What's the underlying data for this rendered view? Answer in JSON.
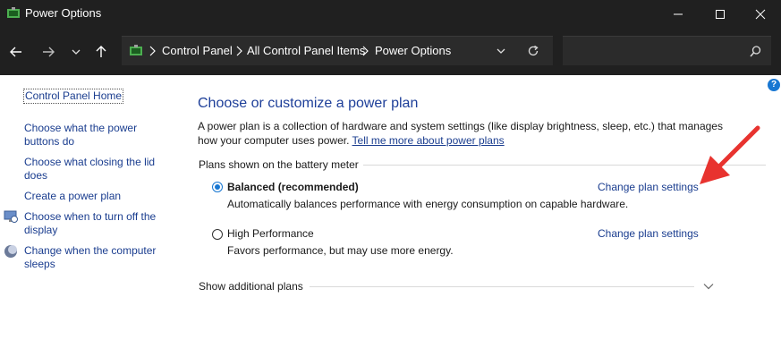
{
  "window": {
    "title": "Power Options",
    "controls": {
      "minimize": "minimize-icon",
      "maximize": "maximize-icon",
      "close": "close-icon"
    }
  },
  "address": {
    "breadcrumbs": [
      "Control Panel",
      "All Control Panel Items",
      "Power Options"
    ],
    "search_placeholder": ""
  },
  "sidebar": {
    "home": "Control Panel Home",
    "items": [
      "Choose what the power buttons do",
      "Choose what closing the lid does",
      "Create a power plan",
      "Choose when to turn off the display",
      "Change when the computer sleeps"
    ]
  },
  "main": {
    "heading": "Choose or customize a power plan",
    "description": "A power plan is a collection of hardware and system settings (like display brightness, sleep, etc.) that manages how your computer uses power.",
    "tell_more_link": "Tell me more about power plans",
    "battery_section": "Plans shown on the battery meter",
    "plans": [
      {
        "name": "Balanced (recommended)",
        "selected": true,
        "description": "Automatically balances performance with energy consumption on capable hardware.",
        "change": "Change plan settings"
      },
      {
        "name": "High Performance",
        "selected": false,
        "description": "Favors performance, but may use more energy.",
        "change": "Change plan settings"
      }
    ],
    "additional_plans": "Show additional plans"
  },
  "help_label": "?",
  "colors": {
    "titlebar": "#202020",
    "link": "#1a3d8f",
    "heading": "#1e3f99",
    "radio": "#1877d2",
    "annotation_arrow": "#e8332f"
  }
}
